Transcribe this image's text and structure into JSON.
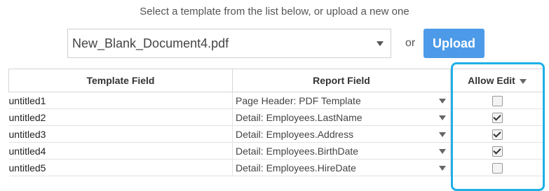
{
  "instruction": "Select a template from the list below, or upload a new one",
  "template_select": {
    "value": "New_Blank_Document4.pdf",
    "caret_icon": "chevron-down-icon"
  },
  "or_label": "or",
  "upload_label": "Upload",
  "colors": {
    "upload": "#4d9be8",
    "highlight": "#1fb0e8"
  },
  "table": {
    "headers": {
      "template_field": "Template Field",
      "report_field": "Report Field",
      "allow_edit": "Allow Edit"
    },
    "rows": [
      {
        "template_field": "untitled1",
        "report_field": "Page Header: PDF Template",
        "allow_edit": false
      },
      {
        "template_field": "untitled2",
        "report_field": "Detail: Employees.LastName",
        "allow_edit": true
      },
      {
        "template_field": "untitled3",
        "report_field": "Detail: Employees.Address",
        "allow_edit": true
      },
      {
        "template_field": "untitled4",
        "report_field": "Detail: Employees.BirthDate",
        "allow_edit": true
      },
      {
        "template_field": "untitled5",
        "report_field": "Detail: Employees.HireDate",
        "allow_edit": false
      }
    ]
  }
}
